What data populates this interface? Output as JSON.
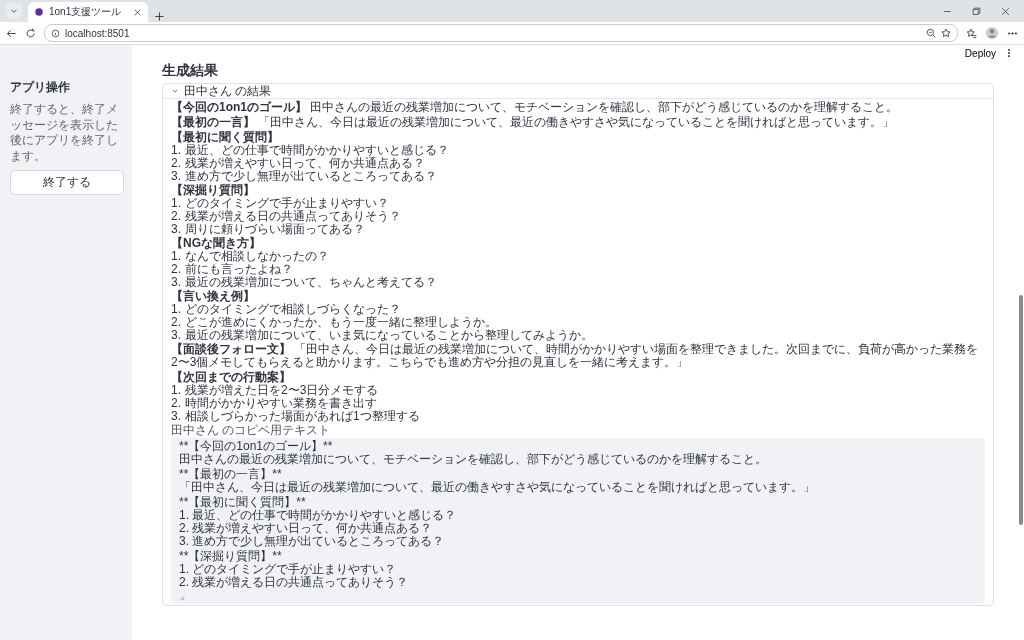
{
  "browser": {
    "tab_title": "1on1支援ツール",
    "url": "localhost:8501"
  },
  "header": {
    "deploy": "Deploy"
  },
  "sidebar": {
    "title": "アプリ操作",
    "description": "終了すると、終了メッセージを表示した後にアプリを終了します。",
    "button": "終了する"
  },
  "main": {
    "title": "生成結果",
    "expander": {
      "label": "田中さん の結果",
      "expanded": true,
      "blocks": [
        {
          "kind": "paragraph",
          "text": "**【今回の1on1のゴール】** 田中さんの最近の残業増加について、モチベーションを確認し、部下がどう感じているのかを理解すること。"
        },
        {
          "kind": "paragraph",
          "text": "**【最初の一言】** 「田中さん、今日は最近の残業増加について、最近の働きやすさや気になっていることを聞ければと思っています。」"
        },
        {
          "kind": "heading",
          "text": "【最初に聞く質問】"
        },
        {
          "kind": "list",
          "items": [
            {
              "marker": "1.",
              "text": "最近、どの仕事で時間がかかりやすいと感じる？"
            },
            {
              "marker": "2.",
              "text": "残業が増えやすい日って、何か共通点ある？"
            },
            {
              "marker": "3.",
              "text": "進め方で少し無理が出ているところってある？"
            }
          ]
        },
        {
          "kind": "heading",
          "text": "【深掘り質問】"
        },
        {
          "kind": "list",
          "items": [
            {
              "marker": "1.",
              "text": "どのタイミングで手が止まりやすい？"
            },
            {
              "marker": "2.",
              "text": "残業が増える日の共通点ってありそう？"
            },
            {
              "marker": "3.",
              "text": "周りに頼りづらい場面ってある？"
            }
          ]
        },
        {
          "kind": "heading",
          "text": "【NGな聞き方】"
        },
        {
          "kind": "list",
          "items": [
            {
              "marker": "1.",
              "text": "なんで相談しなかったの？"
            },
            {
              "marker": "2.",
              "text": "前にも言ったよね？"
            },
            {
              "marker": "3.",
              "text": "最近の残業増加について、ちゃんと考えてる？"
            }
          ]
        },
        {
          "kind": "heading",
          "text": "【言い換え例】"
        },
        {
          "kind": "list",
          "items": [
            {
              "marker": "1.",
              "text": "どのタイミングで相談しづらくなった？"
            },
            {
              "marker": "2.",
              "text": "どこが進めにくかったか、もう一度一緒に整理しようか。"
            },
            {
              "marker": "3.",
              "text": "最近の残業増加について、いま気になっていることから整理してみようか。"
            }
          ]
        },
        {
          "kind": "paragraph",
          "text": "**【面談後フォロー文】** 「田中さん、今日は最近の残業増加について、時間がかかりやすい場面を整理できました。次回までに、負荷が高かった業務を2〜3個メモしてもらえると助かります。こちらでも進め方や分担の見直しを一緒に考えます。」"
        },
        {
          "kind": "heading",
          "text": "【次回までの行動案】"
        },
        {
          "kind": "list",
          "items": [
            {
              "marker": "1.",
              "text": "残業が増えた日を2〜3日分メモする"
            },
            {
              "marker": "2.",
              "text": "時間がかかりやすい業務を書き出す"
            },
            {
              "marker": "3.",
              "text": "相談しづらかった場面があれば1つ整理する"
            }
          ]
        }
      ],
      "copy_label": "田中さん のコピペ用テキスト",
      "copy_sections": [
        [
          "**【今回の1on1のゴール】**",
          "田中さんの最近の残業増加について、モチベーションを確認し、部下がどう感じているのかを理解すること。"
        ],
        [
          "**【最初の一言】**",
          "「田中さん、今日は最近の残業増加について、最近の働きやすさや気になっていることを聞ければと思っています。」"
        ],
        [
          "**【最初に聞く質問】**",
          "1. 最近、どの仕事で時間がかかりやすいと感じる？",
          "2. 残業が増えやすい日って、何か共通点ある？",
          "3. 進め方で少し無理が出ているところってある？"
        ],
        [
          "**【深掘り質問】**",
          "1. どのタイミングで手が止まりやすい？",
          "2. 残業が増える日の共通点ってありそう？"
        ]
      ]
    }
  }
}
